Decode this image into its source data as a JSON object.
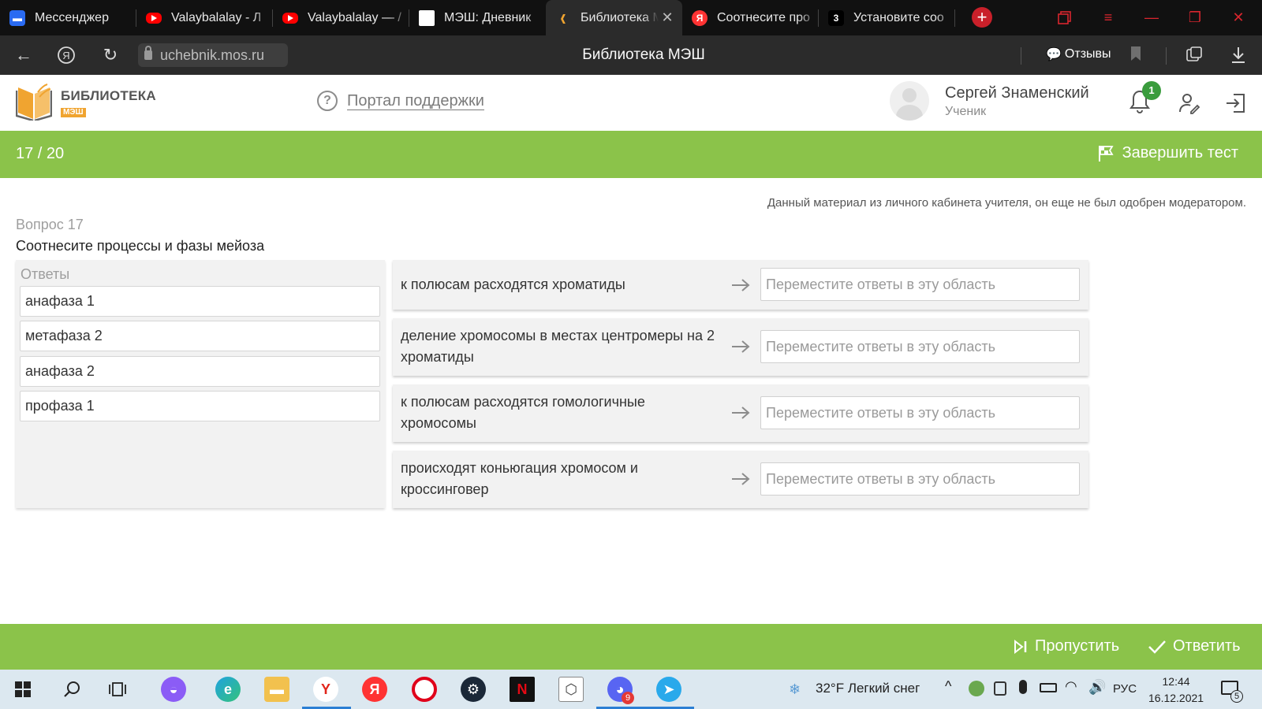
{
  "browser": {
    "tabs": [
      {
        "title": "Мессенджер",
        "favicon": "messenger-icon"
      },
      {
        "title": "Valaybalalay - Л",
        "favicon": "youtube-icon"
      },
      {
        "title": "Valaybalalay — /",
        "favicon": "youtube-icon"
      },
      {
        "title": "МЭШ: Дневник",
        "favicon": "blank-page-icon"
      },
      {
        "title": "Библиотека М",
        "favicon": "library-book-icon",
        "active": true
      },
      {
        "title": "Соотнесите про",
        "favicon": "yandex-icon"
      },
      {
        "title": "Установите соо",
        "favicon": "z-icon"
      }
    ],
    "url": "uchebnik.mos.ru",
    "page_title": "Библиотека МЭШ",
    "reviews_label": "Отзывы"
  },
  "header": {
    "logo_title": "БИБЛИОТЕКА",
    "logo_sub": "МЭШ",
    "support_link": "Портал поддержки",
    "user_name": "Сергей Знаменский",
    "user_role": "Ученик",
    "notifications_count": "1"
  },
  "progress": {
    "counter": "17 / 20",
    "finish_label": "Завершить тест"
  },
  "main": {
    "notice": "Данный материал из личного кабинета учителя, он еще не был одобрен модератором.",
    "question_number": "Вопрос 17",
    "question_text": "Соотнесите процессы и фазы мейоза",
    "answers_title": "Ответы",
    "answers": [
      "анафаза 1",
      "метафаза 2",
      "анафаза 2",
      "профаза 1"
    ],
    "drop_placeholder": "Переместите ответы в эту область",
    "processes": [
      "к полюсам расходятся хроматиды",
      "деление хромосомы в местах центромеры на 2 хроматиды",
      "к полюсам расходятся гомологичные хромосомы",
      "происходят коньюгация хромосом и кроссинговер"
    ]
  },
  "actions": {
    "skip_label": "Пропустить",
    "answer_label": "Ответить"
  },
  "taskbar": {
    "weather": "32°F  Легкий снег",
    "language": "РУС",
    "time": "12:44",
    "date": "16.12.2021",
    "discord_badge": "9",
    "notifications_badge": "5"
  },
  "colors": {
    "accent_green": "#8bc34a",
    "logo_orange": "#f0a430",
    "badge_green": "#3a9c3d"
  }
}
